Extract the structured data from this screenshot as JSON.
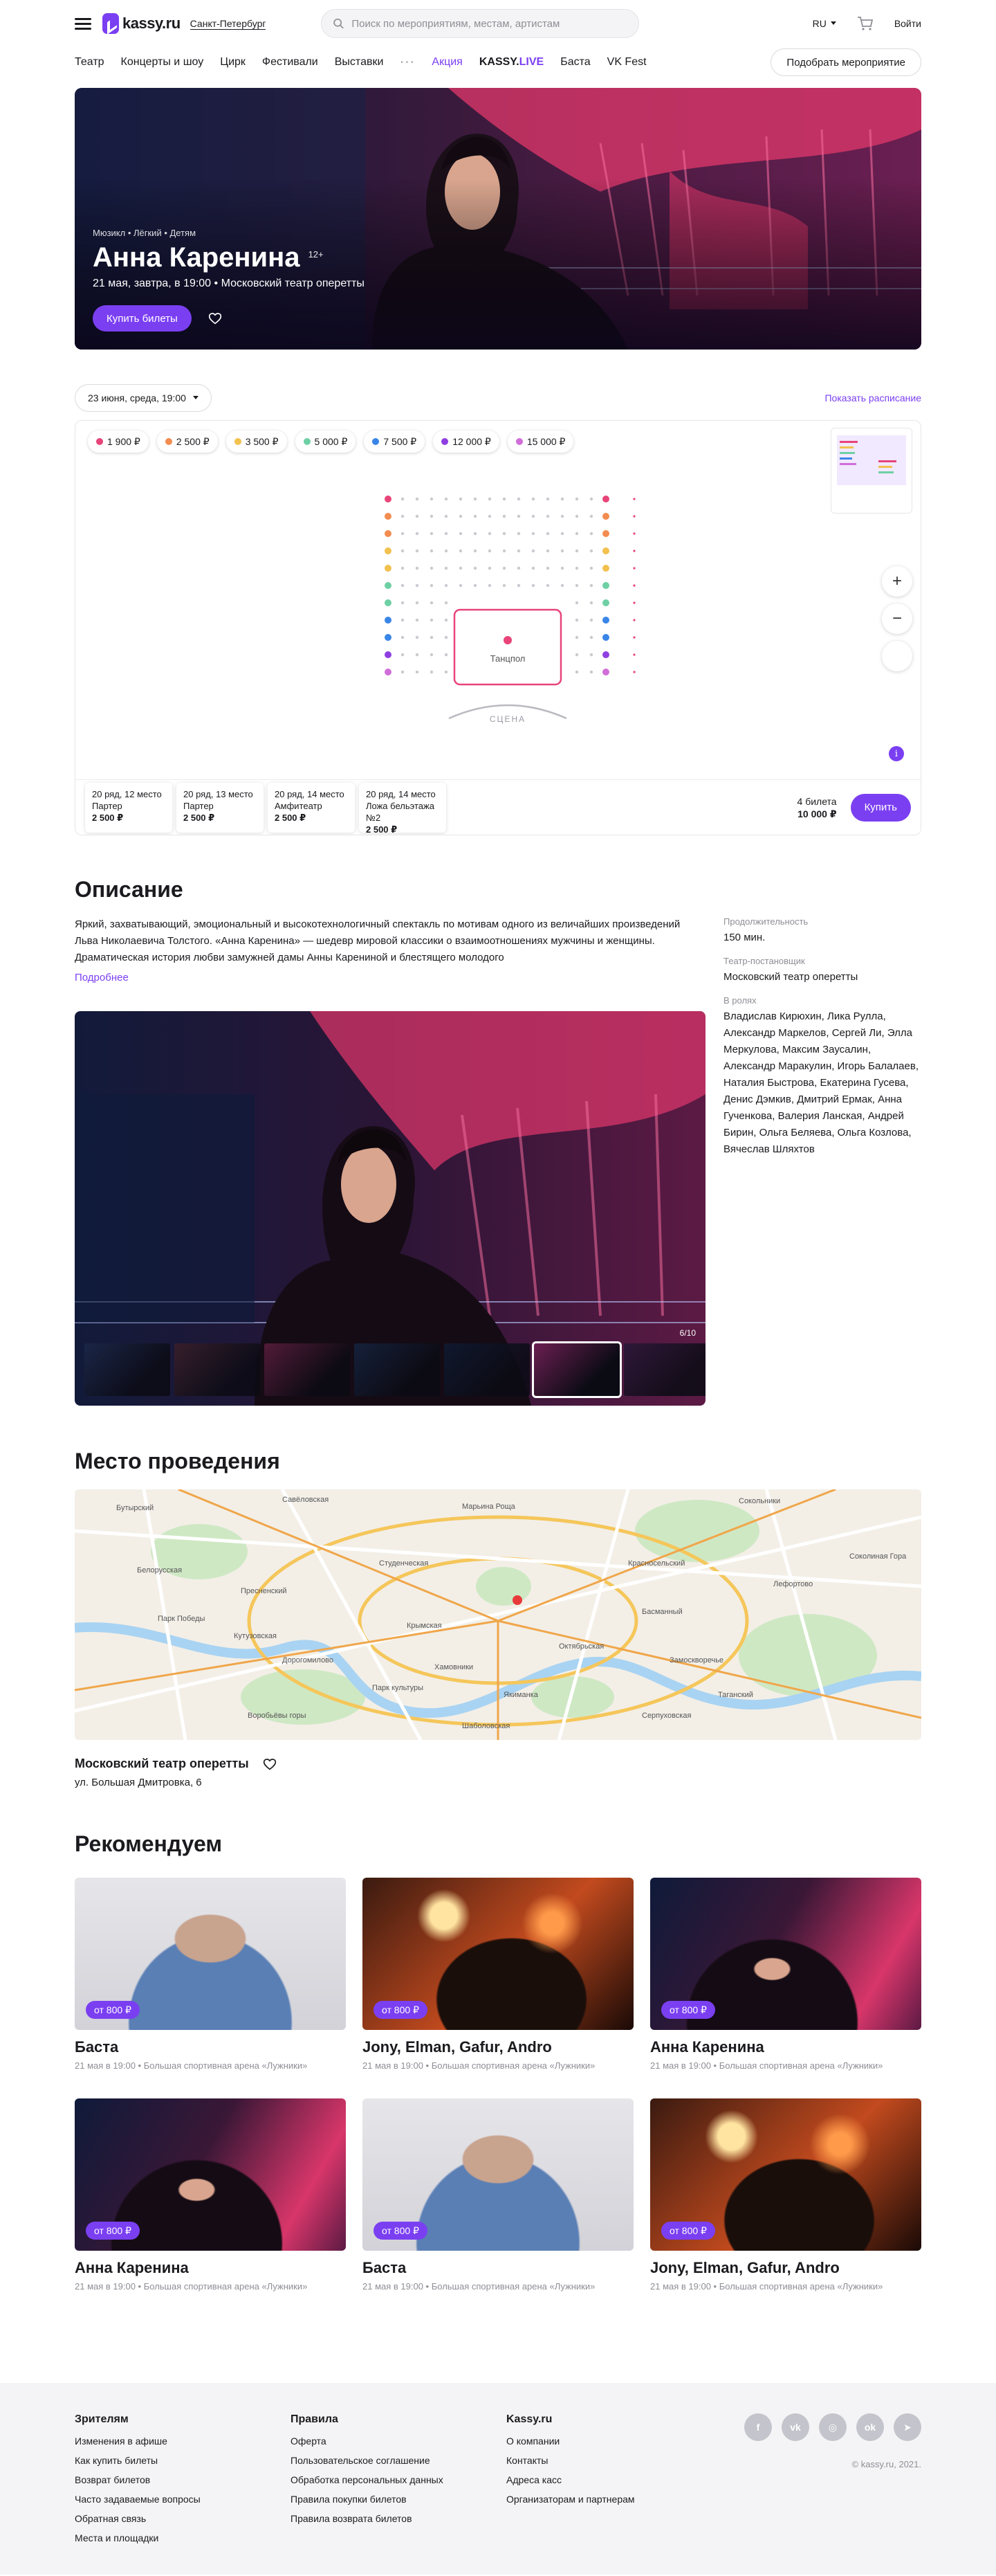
{
  "header": {
    "logo": "kassy.ru",
    "city": "Санкт-Петербург",
    "search_placeholder": "Поиск по мероприятиям, местам, артистам",
    "lang": "RU",
    "login": "Войти"
  },
  "nav": {
    "items": [
      "Театр",
      "Концерты и шоу",
      "Цирк",
      "Фестивали",
      "Выставки"
    ],
    "more": "···",
    "promo": "Акция",
    "live_a": "KASSY.",
    "live_b": "LIVE",
    "extra": [
      "Баста",
      "VK Fest"
    ],
    "pick_button": "Подобрать мероприятие"
  },
  "event": {
    "crumbs": "Мюзикл • Лёгкий • Детям",
    "title": "Анна Каренина",
    "age": "12+",
    "date_line": "21 мая, завтра, в 19:00 • Московский театр оперетты",
    "buy_button": "Купить билеты"
  },
  "schedule": {
    "selected_date": "23 июня, среда, 19:00",
    "show_schedule": "Показать расписание"
  },
  "seatmap": {
    "prices": [
      {
        "label": "1 900 ₽",
        "color": "#e8447a"
      },
      {
        "label": "2 500 ₽",
        "color": "#f28c50"
      },
      {
        "label": "3 500 ₽",
        "color": "#f2c14e"
      },
      {
        "label": "5 000 ₽",
        "color": "#6ed0a4"
      },
      {
        "label": "7 500 ₽",
        "color": "#3a86e8"
      },
      {
        "label": "12 000 ₽",
        "color": "#8f3fe0"
      },
      {
        "label": "15 000 ₽",
        "color": "#d06ed8"
      }
    ],
    "dance_floor": "Танцпол",
    "stage": "СЦЕНА",
    "zoom_in": "+",
    "zoom_out": "−",
    "info": "i",
    "selected": [
      {
        "row": "20 ряд, 12 место",
        "zone": "Партер",
        "price": "2 500 ₽"
      },
      {
        "row": "20 ряд, 13 место",
        "zone": "Партер",
        "price": "2 500 ₽"
      },
      {
        "row": "20 ряд, 14 место",
        "zone": "Амфитеатр",
        "price": "2 500 ₽"
      },
      {
        "row": "20 ряд, 14 место",
        "zone": "Ложа бельэтажа №2",
        "price": "2 500 ₽"
      }
    ],
    "total_count": "4 билета",
    "total_price": "10 000 ₽",
    "buy": "Купить"
  },
  "description": {
    "heading": "Описание",
    "text": "Яркий, захватывающий, эмоциональный и высокотехнологичный спектакль по мотивам одного из величайших произведений Льва Николаевича Толстого. «Анна Каренина» — шедевр мировой классики о взаимоотношениях мужчины и женщины. Драматическая история любви замужней дамы Анны Карениной и блестящего молодого",
    "more": "Подробнее",
    "gallery_counter": "6/10",
    "duration_label": "Продолжительность",
    "duration": "150 мин.",
    "producer_label": "Театр-постановщик",
    "producer": "Московский театр оперетты",
    "cast_label": "В ролях",
    "cast": "Владислав Кирюхин, Лика Рулла, Александр Маркелов, Сергей Ли, Элла Меркулова, Максим Заусалин, Александр Маракулин, Игорь Балалаев, Наталия Быстрова, Екатерина Гусева, Денис Дэмкив, Дмитрий Ермак, Анна Гученкова, Валерия Ланская, Андрей Бирин, Ольга Беляева, Ольга Козлова, Вячеслав Шляхтов"
  },
  "venue": {
    "heading": "Место проведения",
    "name": "Московский театр оперетты",
    "address": "ул. Большая Дмитровка, 6",
    "map_labels": [
      "Бутырский",
      "Савёловская",
      "Марьина Роща",
      "Сокольники",
      "Белорусская",
      "Красносельский",
      "Пресненский",
      "Басманный",
      "Хамовники",
      "Якиманка",
      "Замоскворечье",
      "Лефортово",
      "Таганский",
      "Дорогомилово",
      "Шаболовская",
      "Парк Победы",
      "Кутузовская",
      "Студенческая",
      "Парк культуры",
      "Октябрьская",
      "Крымская",
      "Серпуховская",
      "Воробьёвы горы",
      "Соколиная Гора"
    ]
  },
  "recommend": {
    "heading": "Рекомендуем",
    "cards": [
      {
        "title": "Баста",
        "badge": "от 800 ₽",
        "sub": "21 мая в 19:00 • Большая спортивная арена «Лужники»",
        "img": "man"
      },
      {
        "title": "Jony, Elman, Gafur, Andro",
        "badge": "от 800 ₽",
        "sub": "21 мая в 19:00 • Большая спортивная арена «Лужники»",
        "img": "concert"
      },
      {
        "title": "Анна Каренина",
        "badge": "от 800 ₽",
        "sub": "21 мая в 19:00 • Большая спортивная арена «Лужники»",
        "img": "stage"
      },
      {
        "title": "Анна Каренина",
        "badge": "от 800 ₽",
        "sub": "21 мая в 19:00 • Большая спортивная арена «Лужники»",
        "img": "stage"
      },
      {
        "title": "Баста",
        "badge": "от 800 ₽",
        "sub": "21 мая в 19:00 • Большая спортивная арена «Лужники»",
        "img": "man"
      },
      {
        "title": "Jony, Elman, Gafur, Andro",
        "badge": "от 800 ₽",
        "sub": "21 мая в 19:00 • Большая спортивная арена «Лужники»",
        "img": "concert"
      }
    ]
  },
  "footer": {
    "columns": [
      {
        "title": "Зрителям",
        "links": [
          "Изменения в афише",
          "Как купить билеты",
          "Возврат билетов",
          "Часто задаваемые вопросы",
          "Обратная связь",
          "Места и площадки"
        ]
      },
      {
        "title": "Правила",
        "links": [
          "Оферта",
          "Пользовательское соглашение",
          "Обработка персональных данных",
          "Правила покупки билетов",
          "Правила возврата билетов"
        ]
      },
      {
        "title": "Kassy.ru",
        "links": [
          "О компании",
          "Контакты",
          "Адреса касс",
          "Организаторам и партнерам"
        ]
      }
    ],
    "social": [
      {
        "name": "facebook-icon",
        "glyph": "f"
      },
      {
        "name": "vk-icon",
        "glyph": "vk"
      },
      {
        "name": "instagram-icon",
        "glyph": "◎"
      },
      {
        "name": "odnoklassniki-icon",
        "glyph": "ok"
      },
      {
        "name": "telegram-icon",
        "glyph": "➤"
      }
    ],
    "copyright": "© kassy.ru, 2021."
  }
}
